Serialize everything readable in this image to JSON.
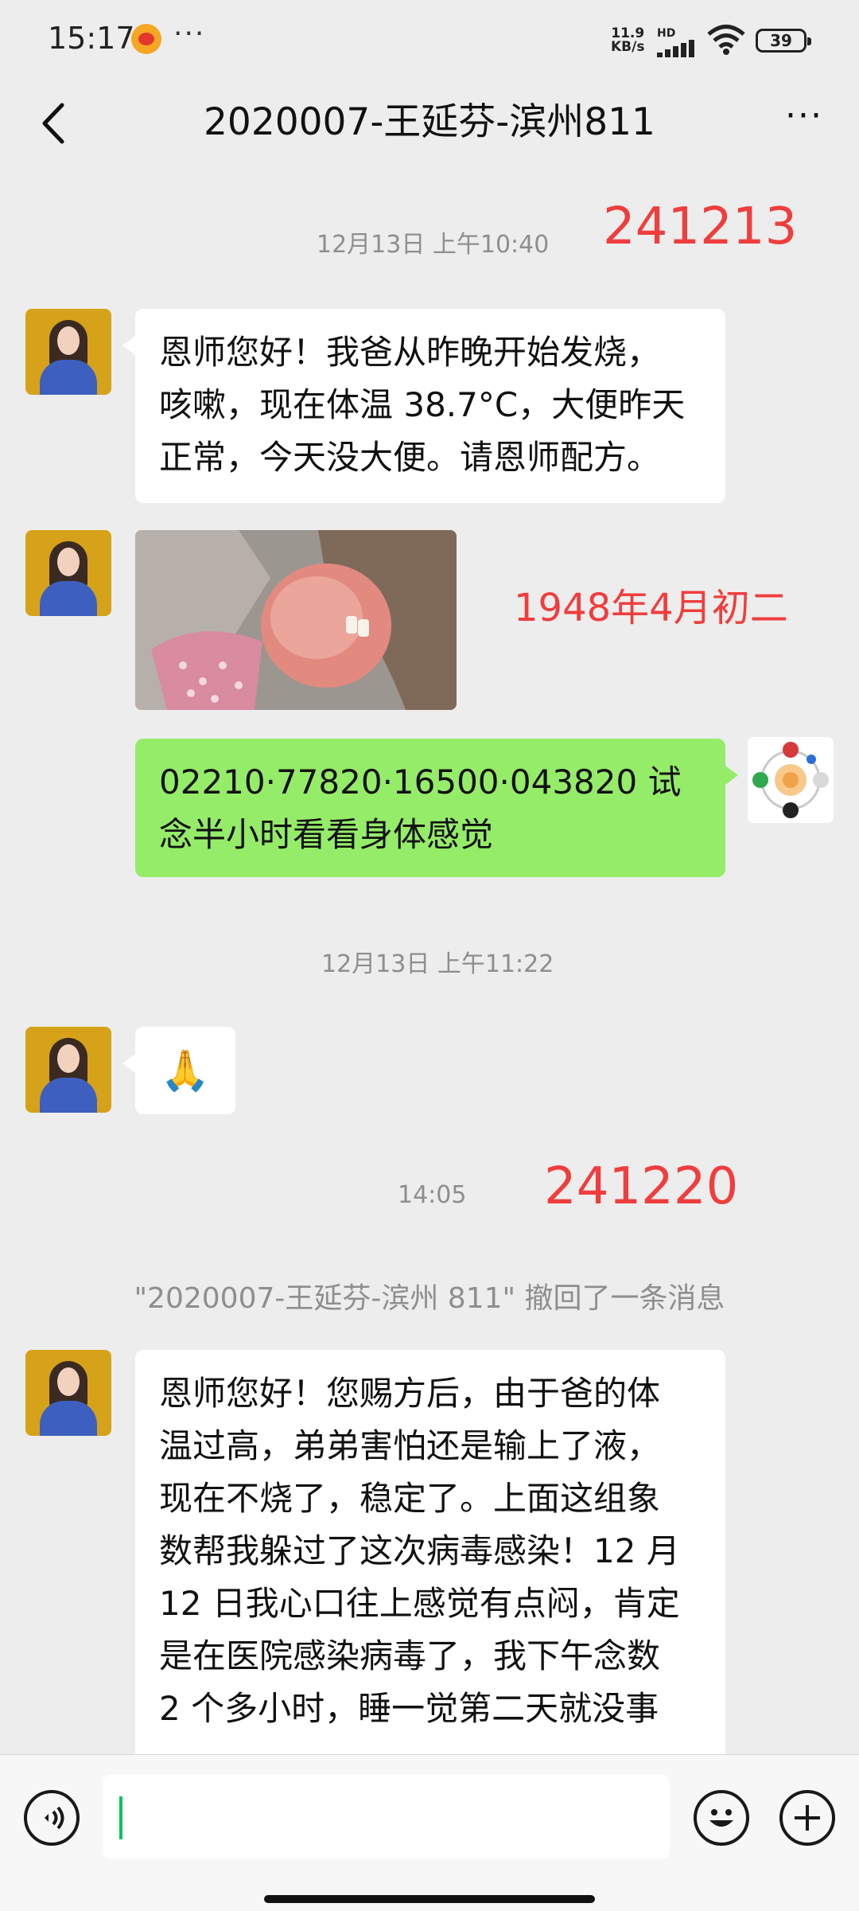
{
  "status_bar": {
    "time": "15:17",
    "net_speed_value": "11.9",
    "net_speed_unit": "KB/s",
    "network_tag": "HD",
    "battery": "39",
    "overflow": "···"
  },
  "header": {
    "title": "2020007-王延芬-滨州811",
    "back_icon": "chevron-left-icon",
    "more_label": "···"
  },
  "messages": {
    "ts1": "12月13日 上午10:40",
    "stamp1": "241213",
    "msg1_line1": "恩师您好！我爸从昨晚开始发烧，",
    "msg1_line2": "咳嗽，现在体温 38.7°C，大便昨天",
    "msg1_line3": "正常，今天没大便。请恩师配方。",
    "photo_caption": "1948年4月初二",
    "reply_line1": "02210·77820·16500·043820 试",
    "reply_line2": "念半小时看看身体感觉",
    "ts2": "12月13日 上午11:22",
    "emoji": "🙏",
    "ts3": "14:05",
    "stamp2": "241220",
    "recall_notice": "\"2020007-王延芬-滨州 811\" 撤回了一条消息",
    "msg3_lines": [
      "恩师您好！您赐方后，由于爸的体",
      "温过高，弟弟害怕还是输上了液，",
      "现在不烧了，稳定了。上面这组象",
      "数帮我躲过了这次病毒感染！12 月",
      "12 日我心口往上感觉有点闷，肯定",
      "是在医院感染病毒了，我下午念数",
      "2 个多小时，睡一觉第二天就没事"
    ]
  },
  "input_bar": {
    "voice_icon": "voice-icon",
    "emoji_icon": "emoji-icon",
    "plus_icon": "plus-icon",
    "input_value": ""
  },
  "colors": {
    "background": "#ededed",
    "bubble_green": "#95ec69",
    "bubble_white": "#ffffff",
    "annotation_red": "#f03d3d",
    "caret_green": "#07c160"
  }
}
